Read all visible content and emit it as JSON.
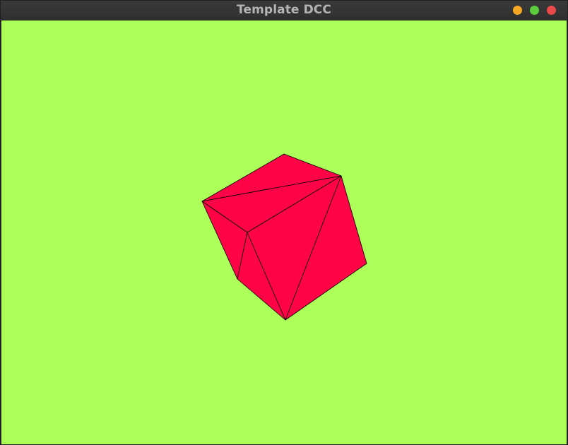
{
  "window": {
    "title": "Template DCC"
  },
  "colors": {
    "minimize_button": "#f5a623",
    "maximize_button": "#5ccb3c",
    "close_button": "#e9494a",
    "viewport_background": "#adff5a",
    "mesh_fill": "#ff0347",
    "mesh_edge": "#000000"
  },
  "viewport": {
    "object": "cube",
    "render_mode": "flat-shaded-with-wireframe"
  }
}
